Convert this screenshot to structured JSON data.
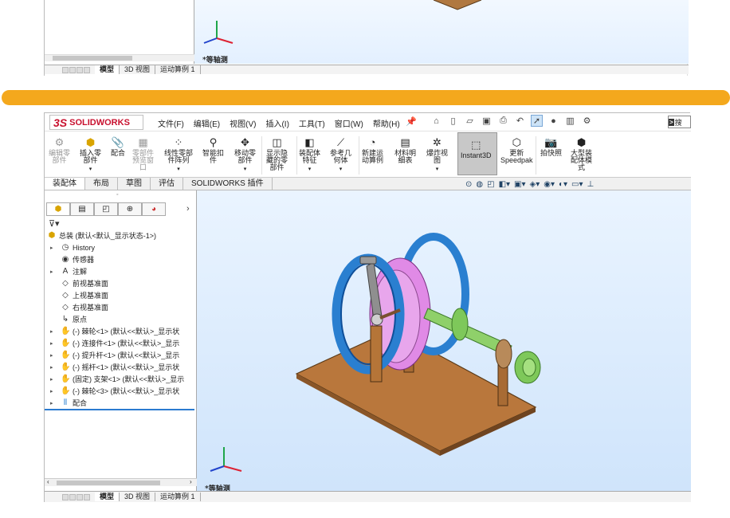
{
  "top_fragment": {
    "view_label": "*等轴测",
    "tabs": [
      "模型",
      "3D 视图",
      "运动算例 1"
    ]
  },
  "app": {
    "logo_ds": "3S",
    "logo_text": "SOLIDWORKS",
    "brand_color": "#c8102e",
    "accent_color": "#f4a81d"
  },
  "menu": [
    "文件(F)",
    "编辑(E)",
    "视图(V)",
    "插入(I)",
    "工具(T)",
    "窗口(W)",
    "帮助(H)"
  ],
  "quick_access_icons": [
    "home-icon",
    "new-doc-icon",
    "open-icon",
    "save-icon",
    "print-icon",
    "undo-icon",
    "select-arrow-icon",
    "traffic-light-icon",
    "rebuild-icon",
    "options-gear-icon"
  ],
  "search": {
    "label": "搜"
  },
  "ribbon": [
    {
      "label": "编辑零\n部件",
      "disabled": true
    },
    {
      "label": "插入零\n部件",
      "disabled": false
    },
    {
      "label": "配合",
      "disabled": false
    },
    {
      "label": "零部件\n预览窗\n口",
      "disabled": true
    },
    {
      "label": "线性零部\n件阵列",
      "disabled": false
    },
    {
      "label": "智能扣\n件",
      "disabled": false
    },
    {
      "label": "移动零\n部件",
      "disabled": false
    },
    {
      "label": "显示隐\n藏的零\n部件",
      "disabled": false
    },
    {
      "label": "装配体\n特征",
      "disabled": false
    },
    {
      "label": "参考几\n何体",
      "disabled": false
    },
    {
      "label": "新建运\n动算例",
      "disabled": false
    },
    {
      "label": "材料明\n细表",
      "disabled": false
    },
    {
      "label": "爆炸视\n图",
      "disabled": false
    },
    {
      "label": "Instant3D",
      "disabled": false
    },
    {
      "label": "更新\nSpeedpak",
      "disabled": false
    },
    {
      "label": "拍快照",
      "disabled": false
    },
    {
      "label": "大型装\n配体模\n式",
      "disabled": false
    }
  ],
  "command_tabs": [
    "装配体",
    "布局",
    "草图",
    "评估",
    "SOLIDWORKS 插件"
  ],
  "feature_tree": [
    {
      "label": "总装  (默认<默认_显示状态-1>)",
      "icon": "assembly-icon",
      "arrow": false,
      "indent": 0
    },
    {
      "label": "History",
      "icon": "history-icon",
      "arrow": true,
      "indent": 1
    },
    {
      "label": "传感器",
      "icon": "sensor-icon",
      "arrow": false,
      "indent": 1
    },
    {
      "label": "注解",
      "icon": "annotation-icon",
      "arrow": true,
      "indent": 1
    },
    {
      "label": "前视基准面",
      "icon": "plane-icon",
      "arrow": false,
      "indent": 1
    },
    {
      "label": "上视基准面",
      "icon": "plane-icon",
      "arrow": false,
      "indent": 1
    },
    {
      "label": "右视基准面",
      "icon": "plane-icon",
      "arrow": false,
      "indent": 1
    },
    {
      "label": "原点",
      "icon": "origin-icon",
      "arrow": false,
      "indent": 1
    },
    {
      "label": "(-) 棘轮<1> (默认<<默认>_显示状",
      "icon": "part-icon",
      "arrow": true,
      "indent": 1
    },
    {
      "label": "(-) 连接件<1> (默认<<默认>_显示",
      "icon": "part-icon",
      "arrow": true,
      "indent": 1
    },
    {
      "label": "(-) 提升杆<1> (默认<<默认>_显示",
      "icon": "part-icon",
      "arrow": true,
      "indent": 1
    },
    {
      "label": "(-) 摇杆<1> (默认<<默认>_显示状",
      "icon": "part-icon",
      "arrow": true,
      "indent": 1
    },
    {
      "label": "(固定) 支架<1> (默认<<默认>_显示",
      "icon": "part-icon",
      "arrow": true,
      "indent": 1
    },
    {
      "label": "(-) 棘轮<3> (默认<<默认>_显示状",
      "icon": "part-icon",
      "arrow": true,
      "indent": 1
    },
    {
      "label": "配合",
      "icon": "mates-icon",
      "arrow": true,
      "indent": 1
    }
  ],
  "graphics": {
    "view_label": "*等轴测"
  },
  "bottom_tabs": [
    "模型",
    "3D 视图",
    "运动算例 1"
  ]
}
